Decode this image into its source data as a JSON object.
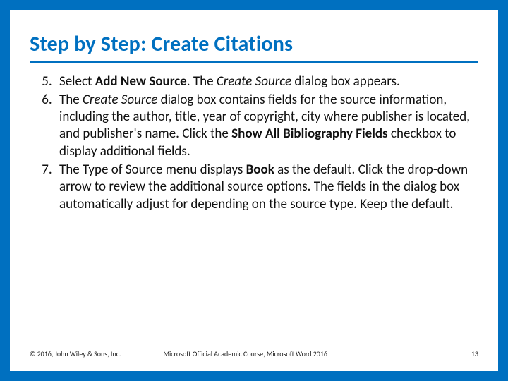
{
  "title": "Step by Step: Create Citations",
  "list_start": 5,
  "steps": {
    "s5": {
      "pre": "Select ",
      "bold1": "Add New Source",
      "mid": ". The ",
      "ital1": "Create Source",
      "post": " dialog box appears."
    },
    "s6": {
      "pre": "The ",
      "ital1": "Create Source",
      "mid": " dialog box contains fields for the source information, including the author, title, year of copyright, city where publisher is located, and publisher's name. Click the ",
      "bold1": "Show All Bibliography Fields",
      "post": " checkbox to display additional fields."
    },
    "s7": {
      "pre": "The Type of Source menu displays ",
      "bold1": "Book",
      "post": " as the default. Click the drop-down arrow to review the additional source options. The fields in the dialog box automatically adjust for depending on the source type. Keep the default."
    }
  },
  "footer": {
    "copyright": "© 2016, John Wiley & Sons, Inc.",
    "course": "Microsoft Official Academic Course, Microsoft Word 2016",
    "page": "13"
  }
}
